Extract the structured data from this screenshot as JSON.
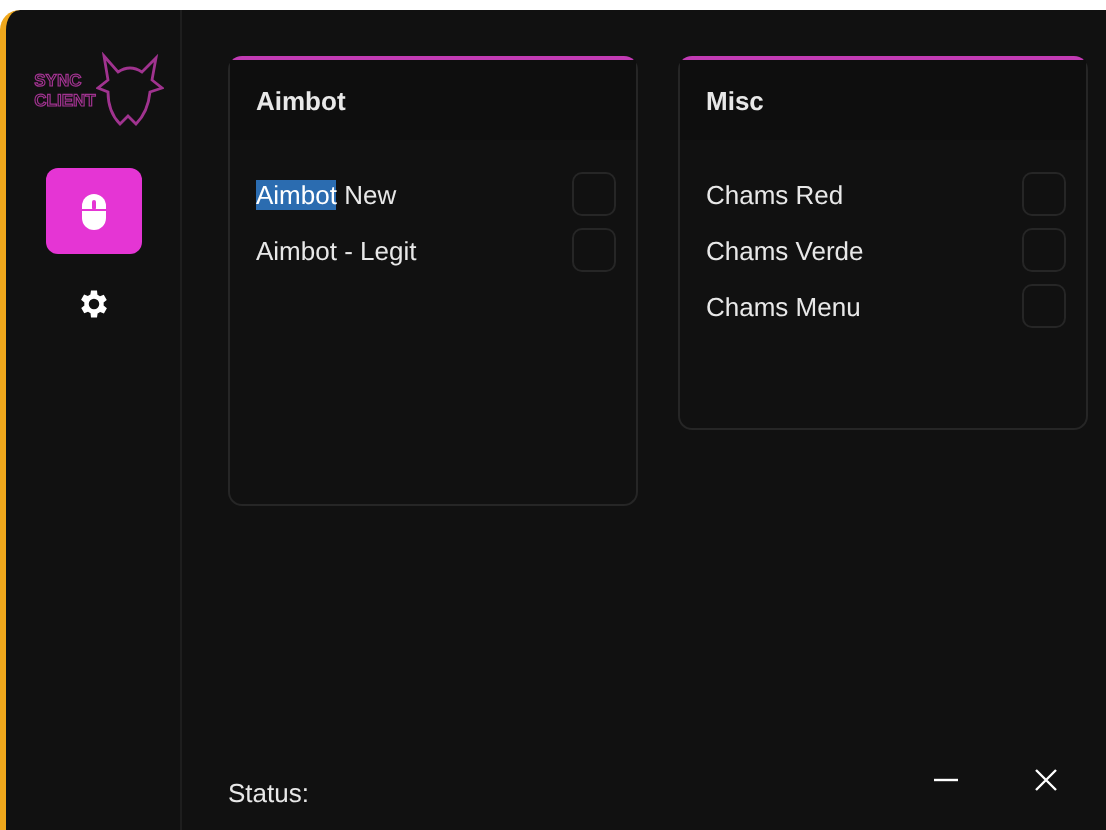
{
  "logo": {
    "line_1": "SYNC",
    "line_2": "CLIENT"
  },
  "sidebar": {
    "items": [
      {
        "kind": "mouse",
        "selected": true
      },
      {
        "kind": "gear",
        "selected": false
      }
    ]
  },
  "panels": [
    {
      "title": "Aimbot",
      "options": [
        {
          "label_parts": [
            {
              "text": "Aimbot",
              "selected": true
            },
            {
              "text": " New",
              "selected": false
            }
          ],
          "checked": false
        },
        {
          "label_parts": [
            {
              "text": "Aimbot - Legit",
              "selected": false
            }
          ],
          "checked": false
        }
      ]
    },
    {
      "title": "Misc",
      "options": [
        {
          "label_parts": [
            {
              "text": "Chams Red",
              "selected": false
            }
          ],
          "checked": false
        },
        {
          "label_parts": [
            {
              "text": "Chams Verde",
              "selected": false
            }
          ],
          "checked": false
        },
        {
          "label_parts": [
            {
              "text": "Chams Menu",
              "selected": false
            }
          ],
          "checked": false
        }
      ]
    }
  ],
  "status": {
    "label": "Status:"
  }
}
